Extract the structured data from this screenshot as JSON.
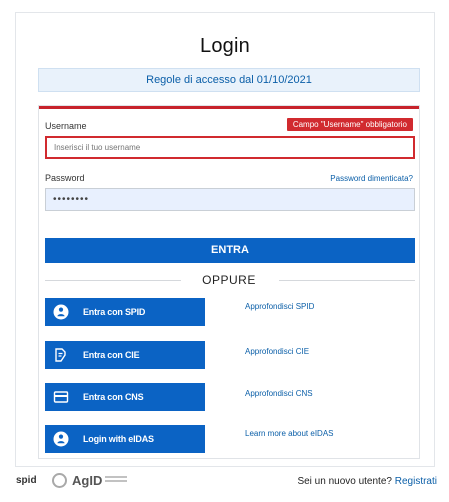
{
  "title": "Login",
  "rules_link": "Regole di accesso dal 01/10/2021",
  "username": {
    "label": "Username",
    "error": "Campo \"Username\" obbligatorio",
    "placeholder": "Inserisci il tuo username"
  },
  "password": {
    "label": "Password",
    "forgot": "Password dimenticata?",
    "value": "••••••••"
  },
  "submit_label": "ENTRA",
  "divider": "OPPURE",
  "auth_options": [
    {
      "label": "Entra con SPID",
      "icon": "spid-user-icon",
      "link": "Approfondisci SPID"
    },
    {
      "label": "Entra con CIE",
      "icon": "cie-card-icon",
      "link": "Approfondisci CIE"
    },
    {
      "label": "Entra con CNS",
      "icon": "cns-card-icon",
      "link": "Approfondisci CNS"
    },
    {
      "label": "Login with eIDAS",
      "icon": "eidas-user-icon",
      "link": "Learn more about eIDAS"
    }
  ],
  "footer": {
    "spid_logo": "spid",
    "agid_logo": "AgID",
    "new_user_text": "Sei un nuovo utente?",
    "register_link": "Registrati"
  },
  "colors": {
    "primary": "#0b63c4",
    "error": "#d12a2f",
    "link": "#0b5fa8",
    "info_bg": "#e9f2fb"
  }
}
